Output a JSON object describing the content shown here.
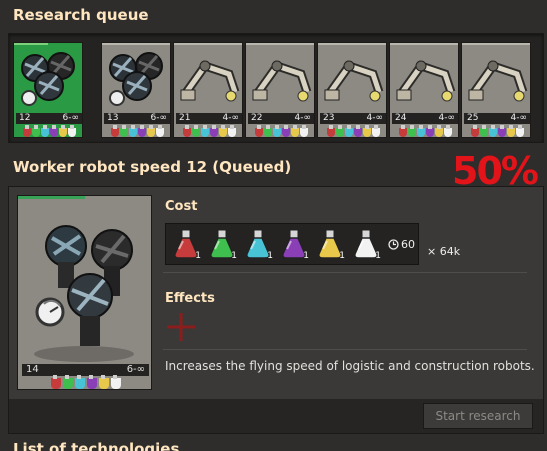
{
  "queue": {
    "title": "Research queue",
    "items": [
      {
        "level": "12",
        "range": "6-∞",
        "kind": "robot",
        "selected": true
      },
      {
        "level": "13",
        "range": "6-∞",
        "kind": "robot"
      },
      {
        "level": "21",
        "range": "4-∞",
        "kind": "arm"
      },
      {
        "level": "22",
        "range": "4-∞",
        "kind": "arm"
      },
      {
        "level": "23",
        "range": "4-∞",
        "kind": "arm"
      },
      {
        "level": "24",
        "range": "4-∞",
        "kind": "arm"
      },
      {
        "level": "25",
        "range": "4-∞",
        "kind": "arm"
      }
    ],
    "selected_progress": 0.5
  },
  "annotation": {
    "text": "50%",
    "color": "#e2141a"
  },
  "detail": {
    "title": "Worker robot speed 12 (Queued)",
    "card": {
      "level": "14",
      "range": "6-∞",
      "progress": 0.5
    },
    "cost": {
      "heading": "Cost",
      "packs": [
        {
          "icon": "automation-science-pack-icon",
          "color": "#c63c3c",
          "count": "1"
        },
        {
          "icon": "logistic-science-pack-icon",
          "color": "#3fbf4d",
          "count": "1"
        },
        {
          "icon": "chemical-science-pack-icon",
          "color": "#48c3d6",
          "count": "1"
        },
        {
          "icon": "production-science-pack-icon",
          "color": "#8b3fb7",
          "count": "1"
        },
        {
          "icon": "utility-science-pack-icon",
          "color": "#e8c84a",
          "count": "1"
        },
        {
          "icon": "space-science-pack-icon",
          "color": "#f2f2f2",
          "count": "1"
        }
      ],
      "time": "60",
      "multiplier": "× 64k"
    },
    "effects": {
      "heading": "Effects",
      "description": "Increases the flying speed of logistic and construction robots."
    },
    "start_label": "Start research"
  },
  "flask_colors": [
    "#c63c3c",
    "#3fbf4d",
    "#48c3d6",
    "#8b3fb7",
    "#e8c84a",
    "#f2f2f2"
  ],
  "next_title": "List of technologies"
}
